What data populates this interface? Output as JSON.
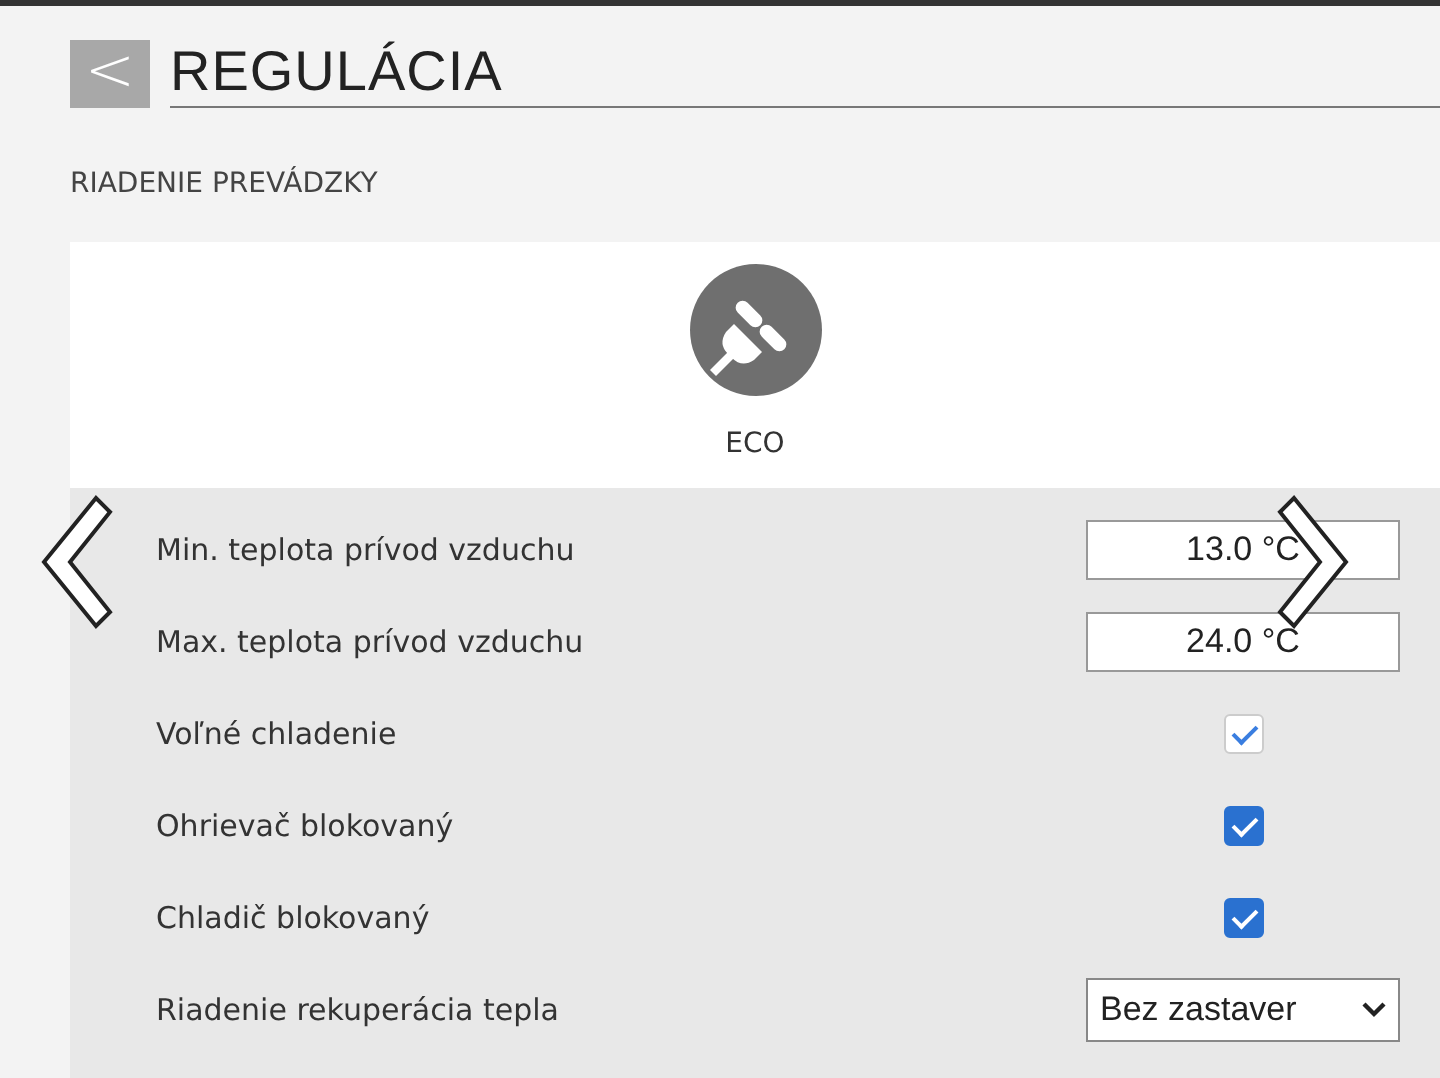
{
  "header": {
    "back_icon": "<",
    "title": "REGULÁCIA"
  },
  "section": {
    "title": "RIADENIE PREVÁDZKY"
  },
  "mode": {
    "label": "ECO"
  },
  "rows": [
    {
      "kind": "input",
      "label": "Min. teplota prívod vzduchu",
      "value": "13.0 °C"
    },
    {
      "kind": "input",
      "label": "Max. teplota prívod vzduchu",
      "value": "24.0 °C"
    },
    {
      "kind": "checkbox",
      "label": "Voľné chladenie",
      "checked": true,
      "disabled": true
    },
    {
      "kind": "checkbox",
      "label": "Ohrievač blokovaný",
      "checked": true,
      "disabled": false
    },
    {
      "kind": "checkbox",
      "label": "Chladič blokovaný",
      "checked": true,
      "disabled": false
    },
    {
      "kind": "select",
      "label": "Riadenie rekuperácia tepla",
      "value": "Bez zastaver"
    }
  ]
}
